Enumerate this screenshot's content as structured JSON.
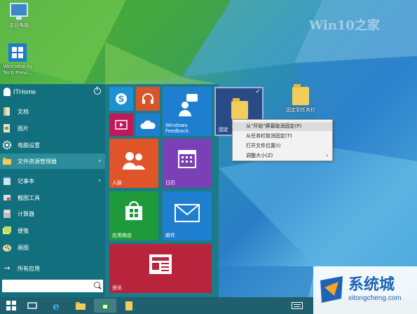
{
  "desktop": {
    "icons": [
      {
        "label": "这台电脑",
        "icon": "computer-icon"
      },
      {
        "label": "Welcome to Tech Previ...",
        "icon": "windows-logo-icon"
      },
      {
        "label": "固定到任务栏",
        "icon": "folder-icon"
      }
    ],
    "watermark": "Win10之家"
  },
  "start_menu": {
    "user_name": "ITHome",
    "items": [
      {
        "label": "文档",
        "icon": "documents-icon",
        "has_arrow": false
      },
      {
        "label": "图片",
        "icon": "pictures-icon",
        "has_arrow": false
      },
      {
        "label": "电脑设置",
        "icon": "gear-icon",
        "has_arrow": false
      },
      {
        "label": "文件资源管理器",
        "icon": "file-explorer-icon",
        "has_arrow": true
      },
      {
        "label": "记事本",
        "icon": "notepad-icon",
        "has_arrow": true
      },
      {
        "label": "截图工具",
        "icon": "snipping-tool-icon",
        "has_arrow": false
      },
      {
        "label": "计算器",
        "icon": "calculator-icon",
        "has_arrow": false
      },
      {
        "label": "便笺",
        "icon": "sticky-notes-icon",
        "has_arrow": false
      },
      {
        "label": "画图",
        "icon": "paint-icon",
        "has_arrow": false
      }
    ],
    "all_apps_label": "所有应用",
    "search_value": ""
  },
  "tiles": {
    "skype": {
      "label": "",
      "color": "#1e90d4"
    },
    "music": {
      "label": "",
      "color": "#d8542a"
    },
    "windows_feedback": {
      "label": "Windows Feedback",
      "color": "#1e7fd0"
    },
    "pinned_folder": {
      "label": "固定",
      "color": "#2a4a86"
    },
    "video": {
      "label": "",
      "color": "#c2185b"
    },
    "onedrive": {
      "label": "",
      "color": "#1e7fd0"
    },
    "people": {
      "label": "人脉",
      "color": "#e0542a"
    },
    "calendar": {
      "label": "日历",
      "color": "#7b3fb8"
    },
    "store": {
      "label": "应用商店",
      "color": "#1e9a3c"
    },
    "mail": {
      "label": "邮件",
      "color": "#1e7fd0"
    },
    "news": {
      "label": "资讯",
      "color": "#b8243c"
    }
  },
  "context_menu": {
    "items": [
      {
        "label": "从\"开始\"屏幕取消固定(P)",
        "has_arrow": false,
        "hover": true
      },
      {
        "label": "从任务栏取消固定(T)",
        "has_arrow": false,
        "hover": false
      },
      {
        "label": "打开文件位置(I)",
        "has_arrow": false,
        "hover": false
      },
      {
        "label": "调整大小(Z)",
        "has_arrow": true,
        "hover": false
      }
    ]
  },
  "branding": {
    "name": "系统城",
    "url": "xitongcheng.com"
  }
}
